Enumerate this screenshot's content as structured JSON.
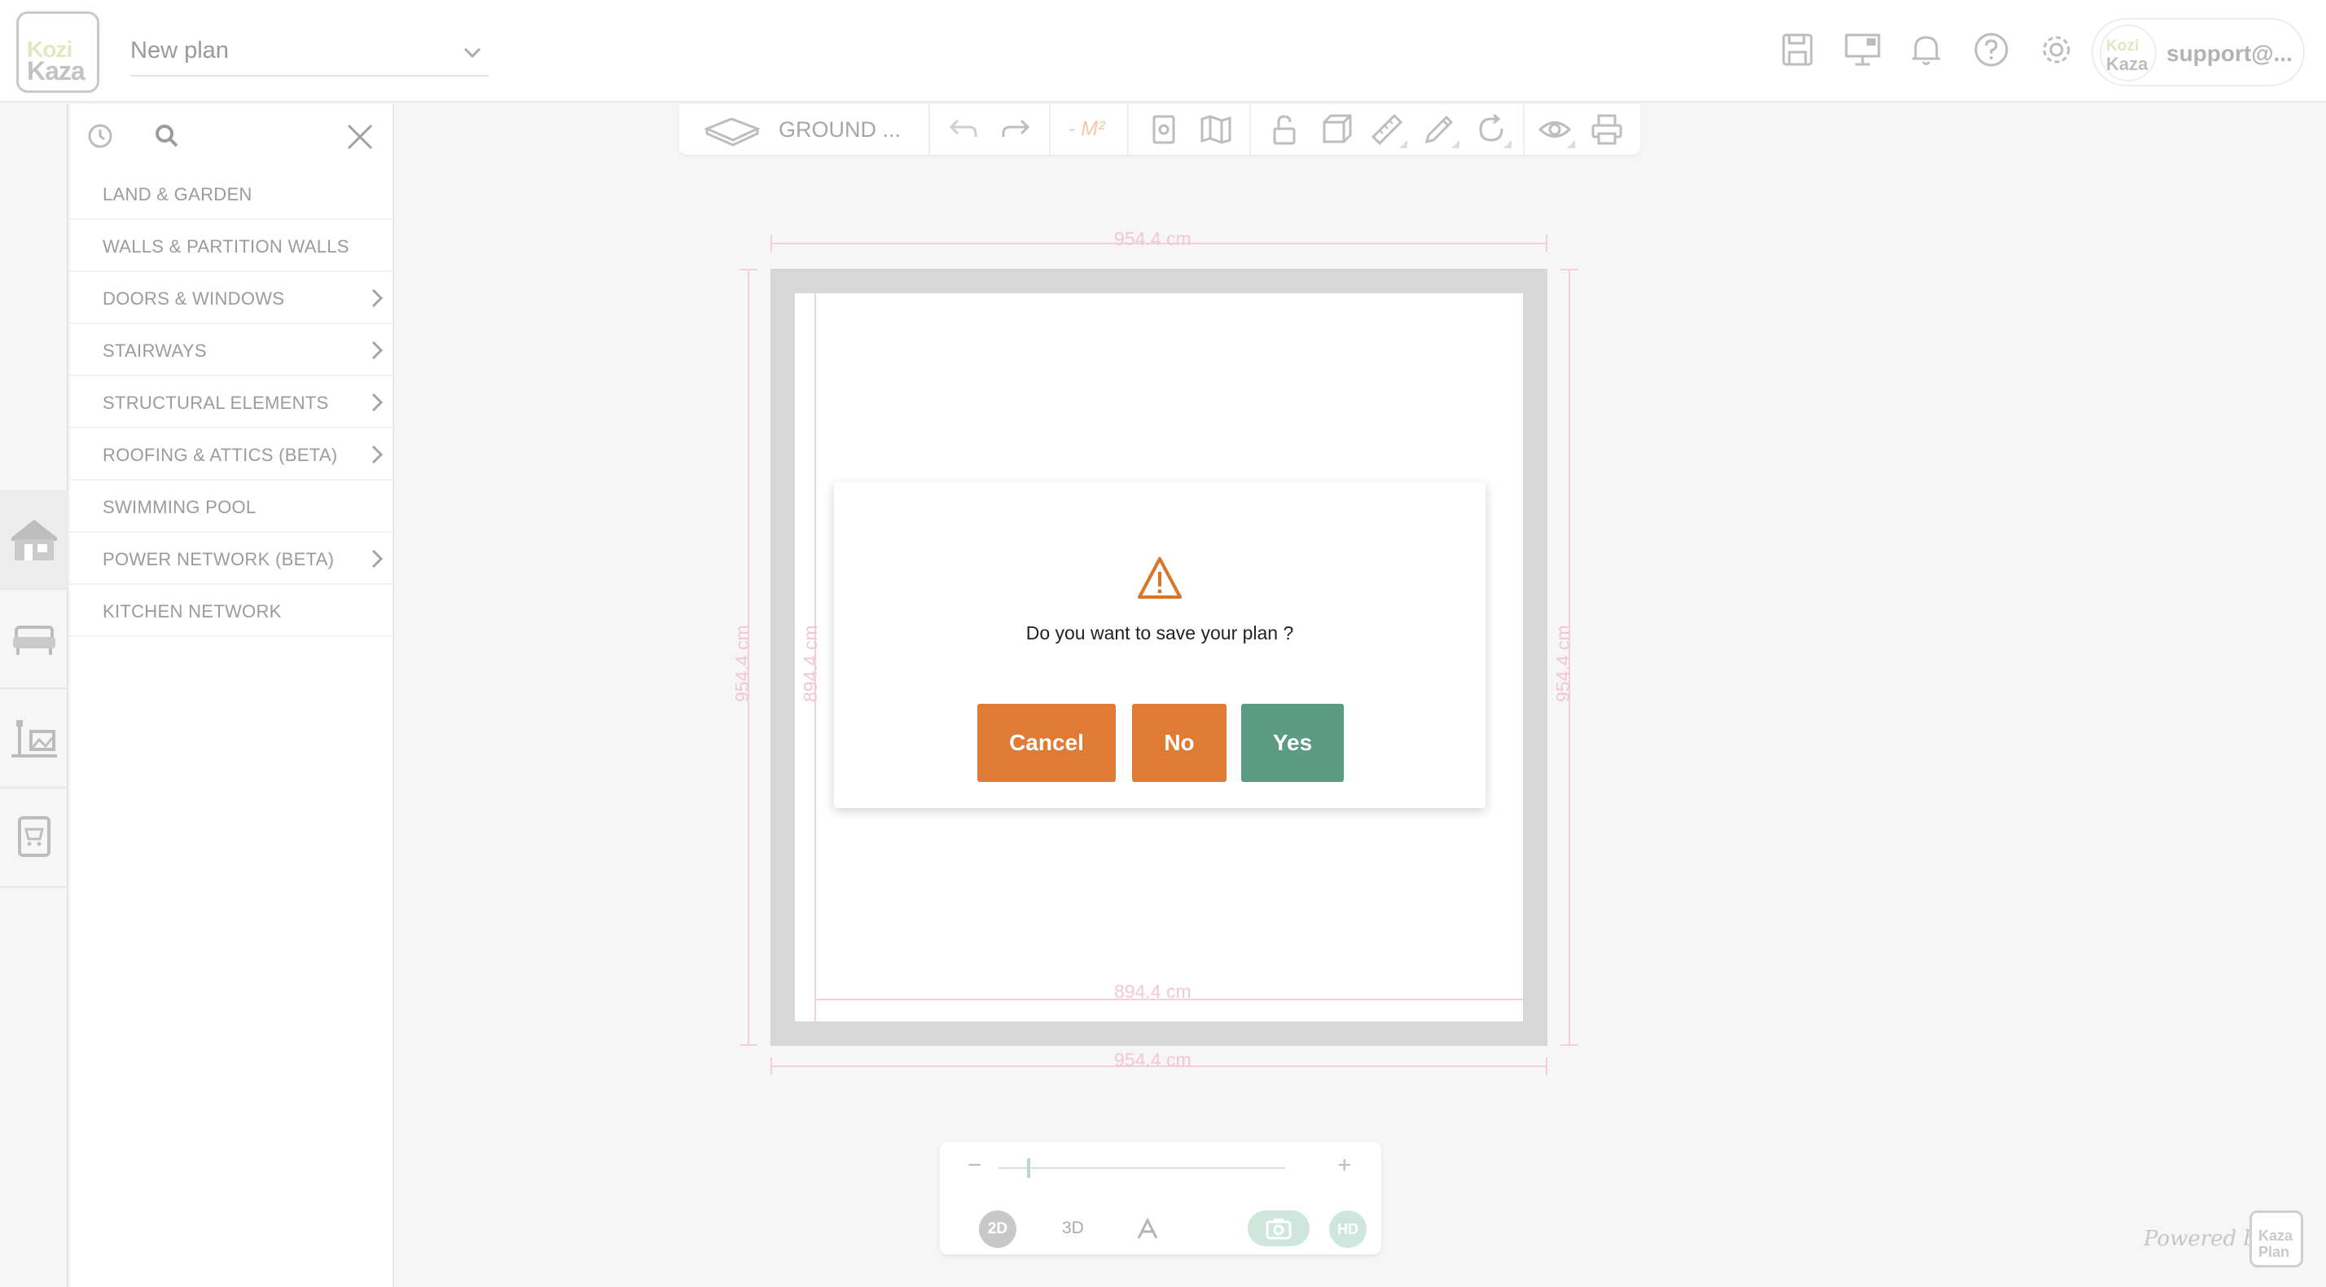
{
  "header": {
    "logo": {
      "line1": "Kozi",
      "line2": "Kaza"
    },
    "plan_name": "New plan",
    "icons": [
      "save-icon",
      "presentation-icon",
      "bell-icon",
      "help-icon",
      "gear-icon"
    ],
    "account": {
      "avatar_line1": "Kozi",
      "avatar_line2": "Kaza",
      "email": "support@..."
    }
  },
  "rail": {
    "items": [
      {
        "name": "house-icon",
        "active": true
      },
      {
        "name": "sofa-icon",
        "active": false
      },
      {
        "name": "decor-icon",
        "active": false
      },
      {
        "name": "cart-icon",
        "active": false
      }
    ]
  },
  "panel": {
    "tools": [
      "history-icon",
      "search-icon",
      "close-icon"
    ],
    "categories": [
      {
        "label": "LAND & GARDEN",
        "has_children": false
      },
      {
        "label": "WALLS & PARTITION WALLS",
        "has_children": false
      },
      {
        "label": "DOORS & WINDOWS",
        "has_children": true
      },
      {
        "label": "STAIRWAYS",
        "has_children": true
      },
      {
        "label": "STRUCTURAL ELEMENTS",
        "has_children": true
      },
      {
        "label": "ROOFING & ATTICS (BETA)",
        "has_children": true
      },
      {
        "label": "SWIMMING POOL",
        "has_children": false
      },
      {
        "label": "POWER NETWORK (BETA)",
        "has_children": true
      },
      {
        "label": "KITCHEN NETWORK",
        "has_children": false
      }
    ]
  },
  "toolbar": {
    "level": "GROUND ...",
    "area": "- M²",
    "icons": [
      "level-icon",
      "undo-icon",
      "redo-icon",
      "area-icon",
      "document-icon",
      "map-icon",
      "unlock-icon",
      "cube-icon",
      "ruler-icon",
      "pencil-icon",
      "rotate-icon",
      "eye-icon",
      "print-icon"
    ]
  },
  "plan": {
    "outer_width": "954.4 cm",
    "outer_height": "954.4 cm",
    "inner_width": "894.4 cm",
    "inner_height": "894.4 cm"
  },
  "dialog": {
    "icon": "warning-icon",
    "message": "Do you want to save your plan ?",
    "cancel": "Cancel",
    "no": "No",
    "yes": "Yes"
  },
  "view_controls": {
    "zoom_minus": "−",
    "zoom_plus": "+",
    "zoom_fraction": 0.1,
    "mode_2d": "2D",
    "mode_3d": "3D",
    "hd": "HD"
  },
  "footer": {
    "powered_by": "Powered by",
    "logo_line1": "Kaza",
    "logo_line2": "Plan"
  },
  "colors": {
    "orange": "#e07b35",
    "green": "#5b9b84",
    "dimension_pink": "#f1c6d6"
  }
}
